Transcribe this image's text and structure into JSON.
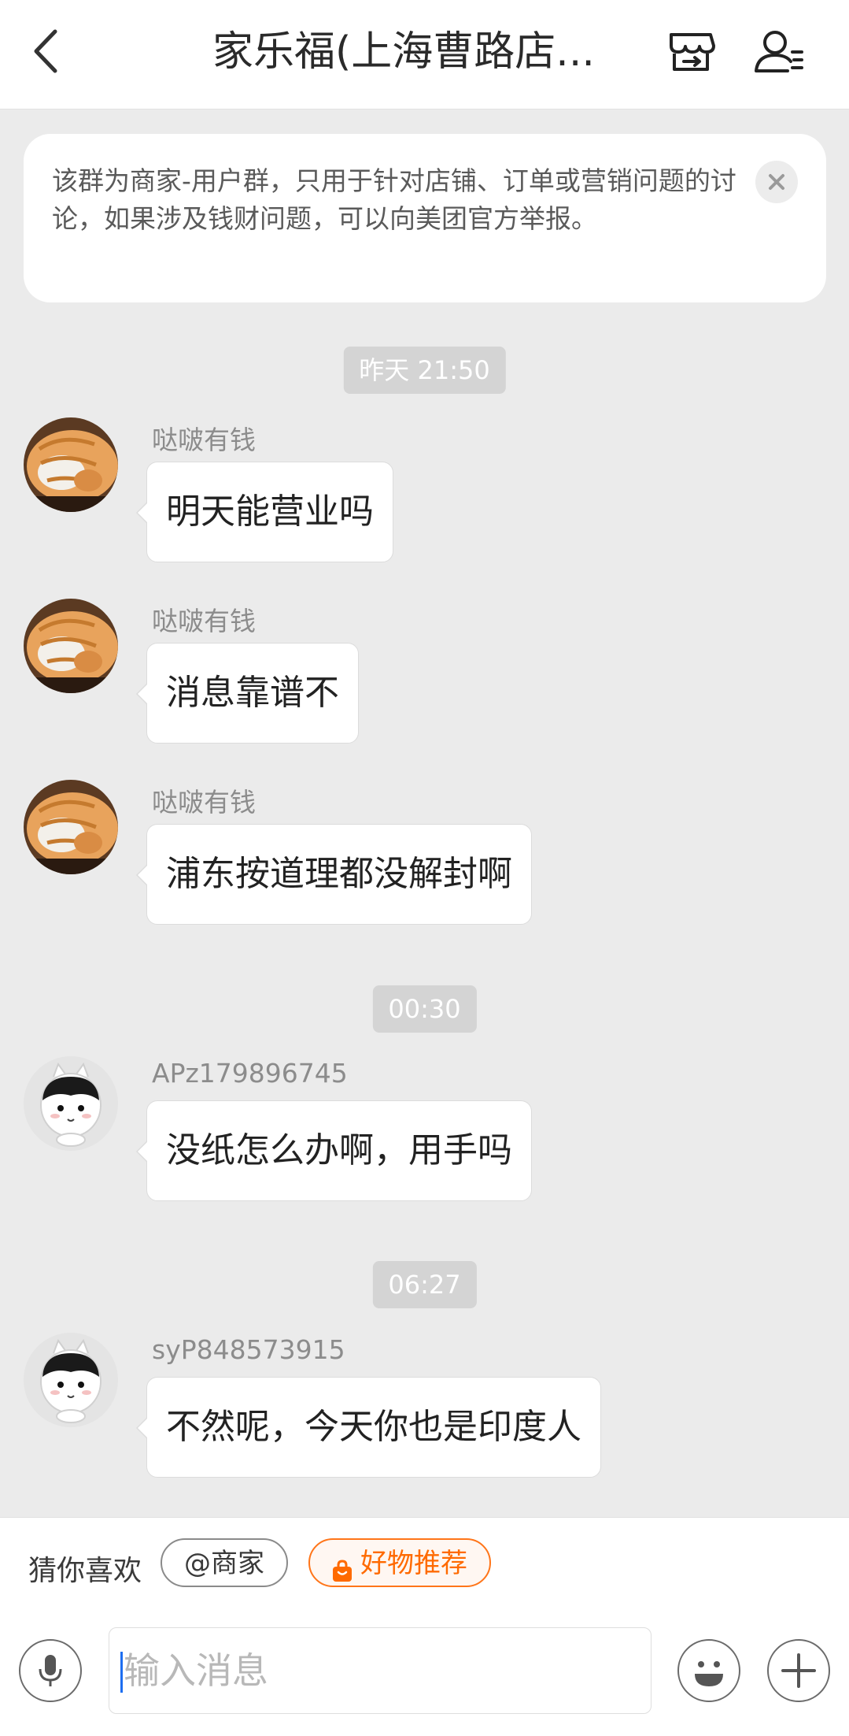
{
  "header": {
    "title": "家乐福(上海曹路店...",
    "icons": [
      "back-arrow-icon",
      "store-exit-icon",
      "group-members-icon"
    ]
  },
  "notice": {
    "text": "该群为商家-用户群，只用于针对店铺、订单或营销问题的讨论，如果涉及钱财问题，可以向美团官方举报。"
  },
  "timestamps": [
    "昨天 21:50",
    "00:30",
    "06:27"
  ],
  "messages": [
    {
      "sender": "哒啵有钱",
      "text": "明天能营业吗",
      "avatar": "cat-avatar"
    },
    {
      "sender": "哒啵有钱",
      "text": "消息靠谱不",
      "avatar": "cat-avatar"
    },
    {
      "sender": "哒啵有钱",
      "text": "浦东按道理都没解封啊",
      "avatar": "cat-avatar"
    },
    {
      "sender": "APz179896745",
      "text": "没纸怎么办啊，用手吗",
      "avatar": "default-avatar"
    },
    {
      "sender": "syP848573915",
      "text": "不然呢，今天你也是印度人",
      "avatar": "default-avatar"
    }
  ],
  "suggestions": {
    "label": "猜你喜欢",
    "chips": [
      "@商家",
      "好物推荐"
    ]
  },
  "input": {
    "placeholder": "输入消息"
  },
  "colors": {
    "accent": "#ff6a00",
    "caret": "#1d6ef0",
    "background": "#ebebeb"
  }
}
